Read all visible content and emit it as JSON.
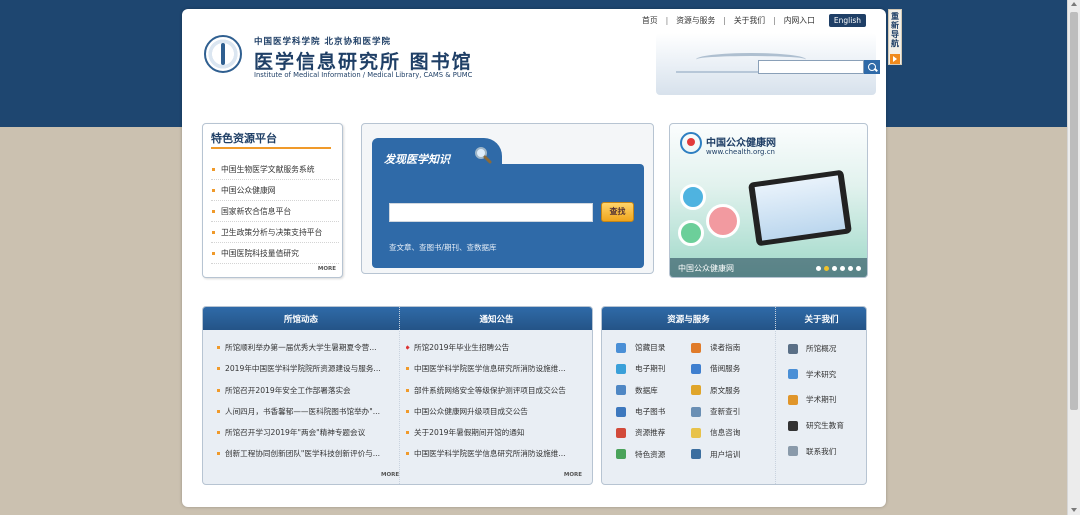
{
  "header": {
    "org_line": "中国医学科学院  北京协和医学院",
    "site_name": "医学信息研究所  图书馆",
    "site_name_en": "Institute of Medical Information / Medical Library, CAMS & PUMC",
    "nav": {
      "home": "首页",
      "resources": "资源与服务",
      "about": "关于我们",
      "intranet": "内网入口",
      "english": "English"
    },
    "search_placeholder": ""
  },
  "side_tab": {
    "label": "重新导航"
  },
  "featured": {
    "title": "特色资源平台",
    "items": [
      "中国生物医学文献服务系统",
      "中国公众健康网",
      "国家新农合信息平台",
      "卫生政策分析与决策支持平台",
      "中国医院科技量值研究"
    ],
    "more": "MORE"
  },
  "discover": {
    "title": "发现医学知识",
    "button": "查找",
    "hint": "查文章、查图书/期刊、查数据库",
    "input_value": ""
  },
  "banner": {
    "title": "中国公众健康网",
    "url": "www.chealth.org.cn",
    "caption": "中国公众健康网",
    "slides": 6,
    "active_slide": 2
  },
  "news": {
    "tab1": "所馆动态",
    "tab2": "通知公告",
    "dynamics": [
      "所馆顺利举办第一届优秀大学生暑期夏令营...",
      "2019年中国医学科学院院所资源建设与服务...",
      "所馆召开2019年安全工作部署落实会",
      "人间四月，书香馨郁——医科院图书馆举办\"...",
      "所馆召开学习2019年\"两会\"精神专题会议",
      "创新工程协同创新团队\"医学科技创新评价与..."
    ],
    "notices": [
      "所馆2019年毕业生招聘公告",
      "中国医学科学院医学信息研究所消防设施维...",
      "部件系统网络安全等级保护测评项目成交公告",
      "中国公众健康网升级项目成交公告",
      "关于2019年暑假期间开馆的通知",
      "中国医学科学院医学信息研究所消防设施维..."
    ],
    "more": "MORE"
  },
  "resources": {
    "title": "资源与服务",
    "items": [
      {
        "label": "馆藏目录",
        "icon": "catalog-icon",
        "color": "#4a8fd6"
      },
      {
        "label": "读者指南",
        "icon": "guide-icon",
        "color": "#e07b2a"
      },
      {
        "label": "电子期刊",
        "icon": "ejournal-icon",
        "color": "#3aa0d9"
      },
      {
        "label": "借阅服务",
        "icon": "borrow-icon",
        "color": "#3f7fcf"
      },
      {
        "label": "数据库",
        "icon": "database-icon",
        "color": "#4f87c4"
      },
      {
        "label": "原文服务",
        "icon": "fulltext-icon",
        "color": "#e0a52a"
      },
      {
        "label": "电子图书",
        "icon": "ebook-icon",
        "color": "#3d78be"
      },
      {
        "label": "查新查引",
        "icon": "search-cite-icon",
        "color": "#6a8fb4"
      },
      {
        "label": "资源推荐",
        "icon": "recommend-icon",
        "color": "#d24a3a"
      },
      {
        "label": "信息咨询",
        "icon": "consult-icon",
        "color": "#e8c24a"
      },
      {
        "label": "特色资源",
        "icon": "special-icon",
        "color": "#4aa35a"
      },
      {
        "label": "用户培训",
        "icon": "training-icon",
        "color": "#3c6e9f"
      }
    ]
  },
  "about": {
    "title": "关于我们",
    "items": [
      {
        "label": "所馆概况",
        "icon": "building-icon",
        "color": "#5a6f86"
      },
      {
        "label": "学术研究",
        "icon": "research-icon",
        "color": "#4a8fd6"
      },
      {
        "label": "学术期刊",
        "icon": "journal-icon",
        "color": "#e0952a"
      },
      {
        "label": "研究生教育",
        "icon": "graduate-icon",
        "color": "#333333"
      },
      {
        "label": "联系我们",
        "icon": "contact-icon",
        "color": "#8a9aaa"
      }
    ]
  }
}
